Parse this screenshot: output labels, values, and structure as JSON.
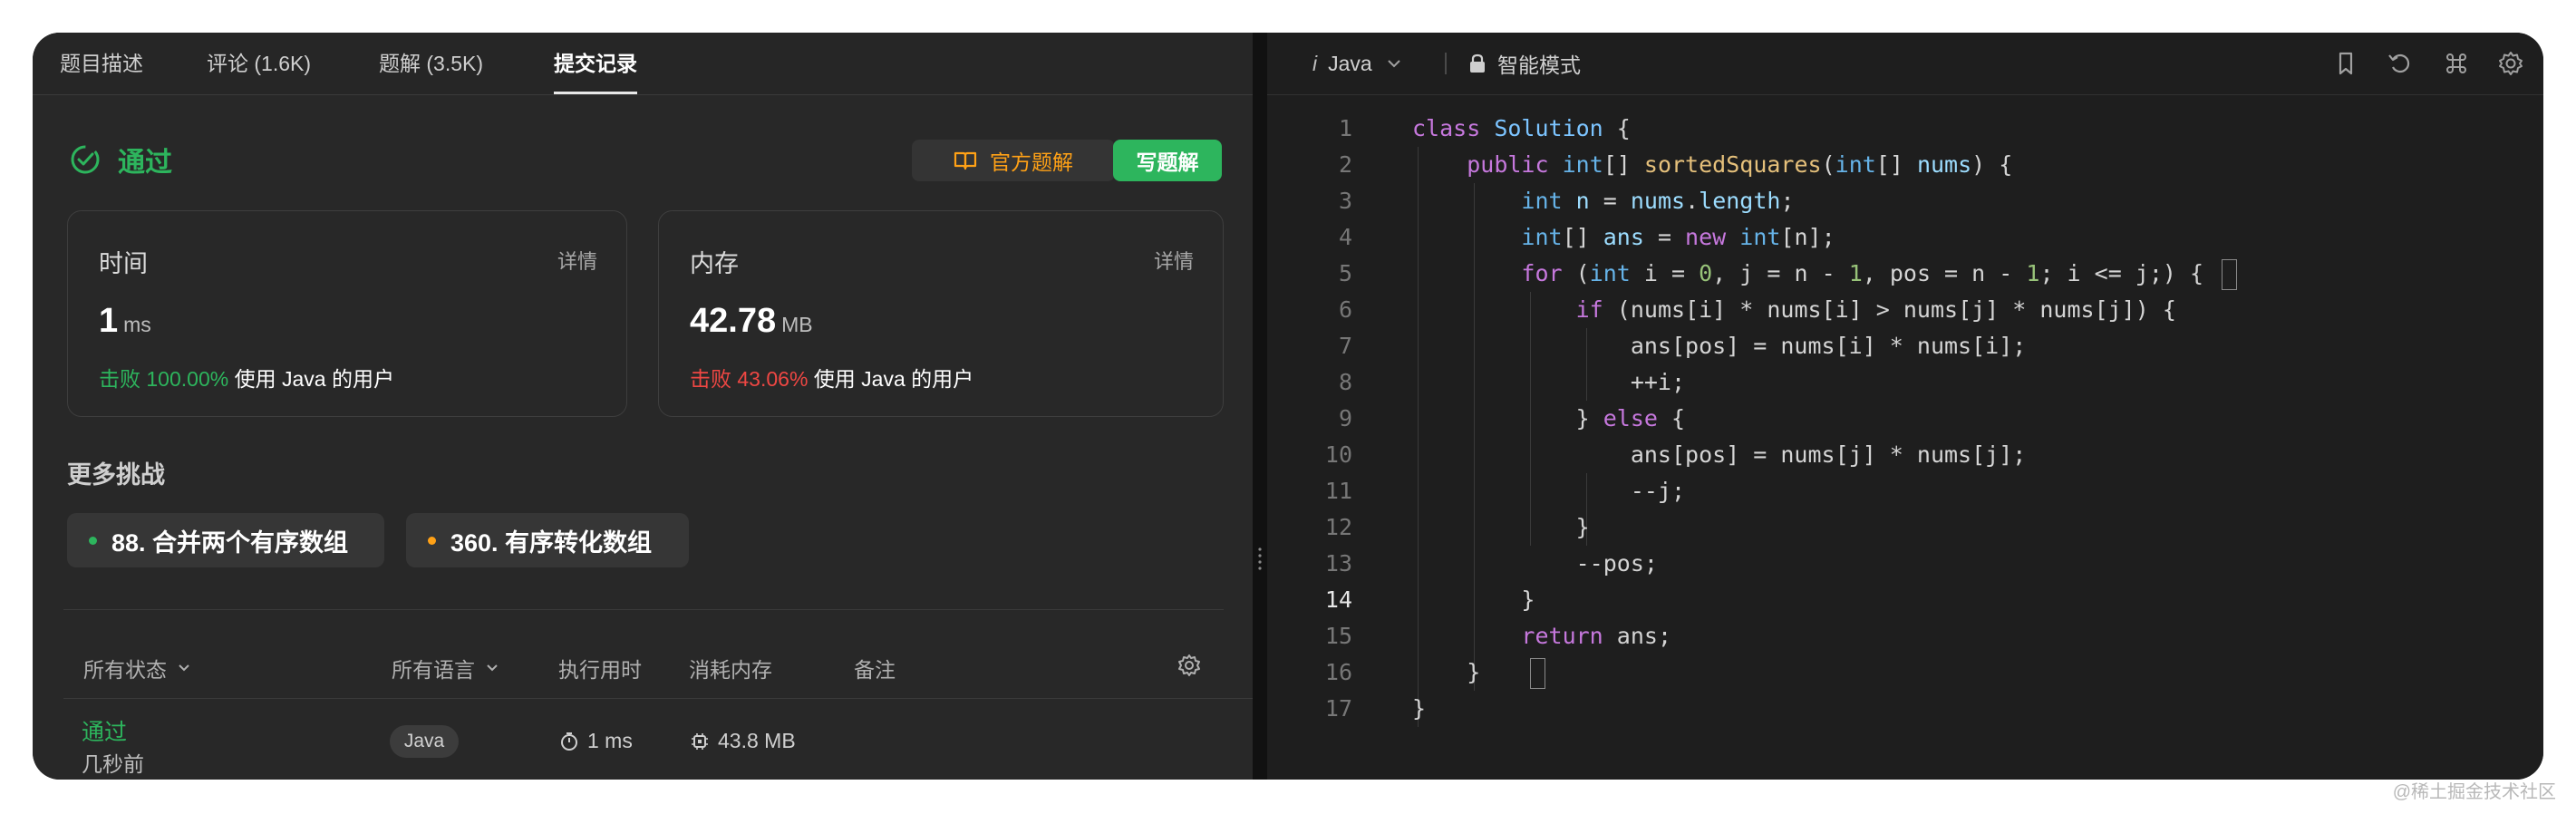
{
  "tabs": [
    "题目描述",
    "评论 (1.6K)",
    "题解 (3.5K)",
    "提交记录"
  ],
  "submission": {
    "status": "通过",
    "official_solution_label": "官方题解",
    "write_solution_label": "写题解",
    "time_card": {
      "title": "时间",
      "detail": "详情",
      "value": "1",
      "unit": "ms",
      "beat_label": "击败 100.00%",
      "beat_suffix": "使用 Java 的用户"
    },
    "memory_card": {
      "title": "内存",
      "detail": "详情",
      "value": "42.78",
      "unit": "MB",
      "beat_label": "击败 43.06%",
      "beat_suffix": "使用 Java 的用户"
    }
  },
  "more": {
    "title": "更多挑战",
    "items": [
      {
        "label": "88. 合并两个有序数组",
        "color": "#2db55d"
      },
      {
        "label": "360. 有序转化数组",
        "color": "#ffa116"
      }
    ]
  },
  "table": {
    "headers": {
      "status": "所有状态",
      "language": "所有语言",
      "runtime": "执行用时",
      "memory": "消耗内存",
      "notes": "备注"
    },
    "rows": [
      {
        "status": "通过",
        "time_ago": "几秒前",
        "language": "Java",
        "runtime": "1 ms",
        "memory": "43.8 MB"
      }
    ]
  },
  "editor": {
    "language": "Java",
    "language_prefix": "i",
    "mode": "智能模式",
    "current_line": 14
  },
  "watermark": "@稀土掘金技术社区",
  "colors": {
    "accepted": "#2db55d",
    "official": "#ffa116",
    "beat_low": "#ef4743"
  }
}
